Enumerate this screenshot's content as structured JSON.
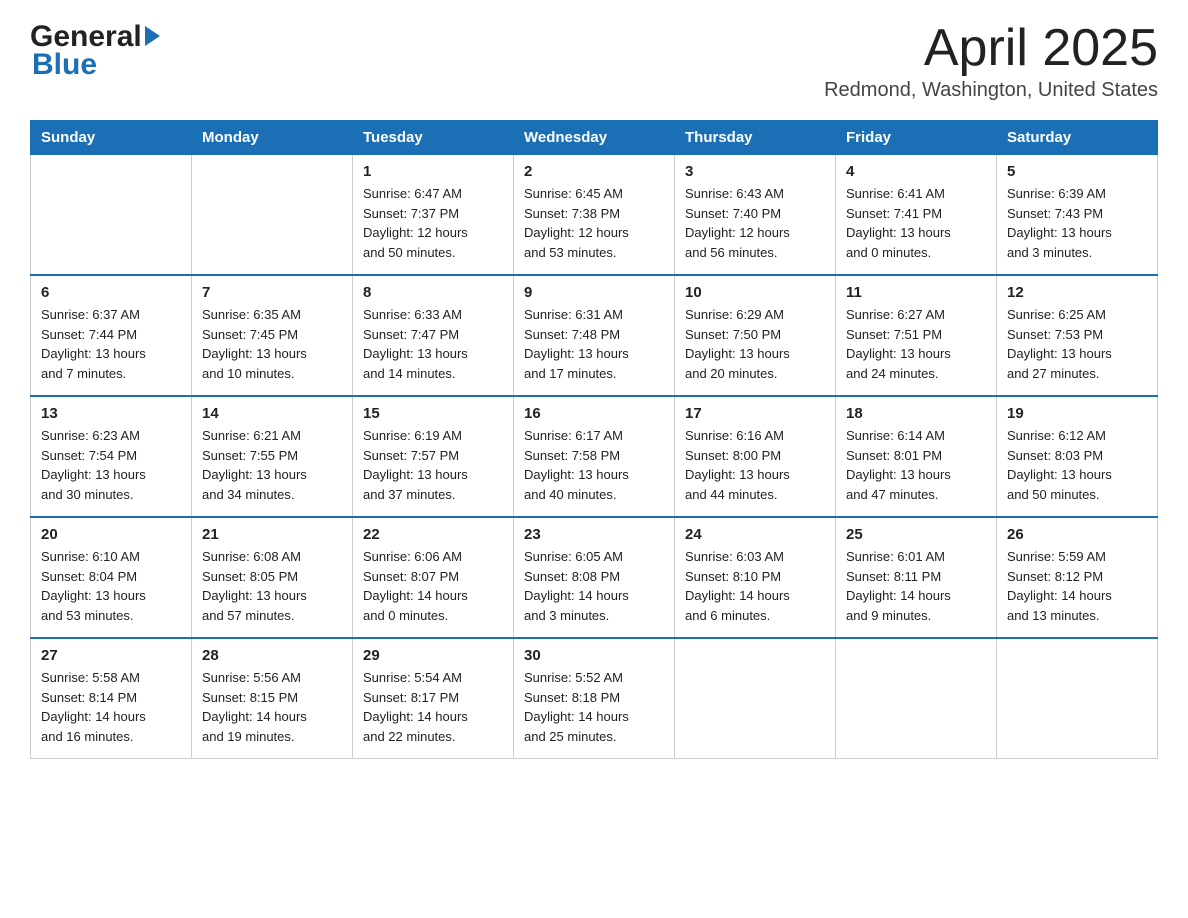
{
  "header": {
    "logo_general": "General",
    "logo_blue": "Blue",
    "month_title": "April 2025",
    "location": "Redmond, Washington, United States"
  },
  "calendar": {
    "days_of_week": [
      "Sunday",
      "Monday",
      "Tuesday",
      "Wednesday",
      "Thursday",
      "Friday",
      "Saturday"
    ],
    "weeks": [
      [
        {
          "day": "",
          "info": ""
        },
        {
          "day": "",
          "info": ""
        },
        {
          "day": "1",
          "info": "Sunrise: 6:47 AM\nSunset: 7:37 PM\nDaylight: 12 hours\nand 50 minutes."
        },
        {
          "day": "2",
          "info": "Sunrise: 6:45 AM\nSunset: 7:38 PM\nDaylight: 12 hours\nand 53 minutes."
        },
        {
          "day": "3",
          "info": "Sunrise: 6:43 AM\nSunset: 7:40 PM\nDaylight: 12 hours\nand 56 minutes."
        },
        {
          "day": "4",
          "info": "Sunrise: 6:41 AM\nSunset: 7:41 PM\nDaylight: 13 hours\nand 0 minutes."
        },
        {
          "day": "5",
          "info": "Sunrise: 6:39 AM\nSunset: 7:43 PM\nDaylight: 13 hours\nand 3 minutes."
        }
      ],
      [
        {
          "day": "6",
          "info": "Sunrise: 6:37 AM\nSunset: 7:44 PM\nDaylight: 13 hours\nand 7 minutes."
        },
        {
          "day": "7",
          "info": "Sunrise: 6:35 AM\nSunset: 7:45 PM\nDaylight: 13 hours\nand 10 minutes."
        },
        {
          "day": "8",
          "info": "Sunrise: 6:33 AM\nSunset: 7:47 PM\nDaylight: 13 hours\nand 14 minutes."
        },
        {
          "day": "9",
          "info": "Sunrise: 6:31 AM\nSunset: 7:48 PM\nDaylight: 13 hours\nand 17 minutes."
        },
        {
          "day": "10",
          "info": "Sunrise: 6:29 AM\nSunset: 7:50 PM\nDaylight: 13 hours\nand 20 minutes."
        },
        {
          "day": "11",
          "info": "Sunrise: 6:27 AM\nSunset: 7:51 PM\nDaylight: 13 hours\nand 24 minutes."
        },
        {
          "day": "12",
          "info": "Sunrise: 6:25 AM\nSunset: 7:53 PM\nDaylight: 13 hours\nand 27 minutes."
        }
      ],
      [
        {
          "day": "13",
          "info": "Sunrise: 6:23 AM\nSunset: 7:54 PM\nDaylight: 13 hours\nand 30 minutes."
        },
        {
          "day": "14",
          "info": "Sunrise: 6:21 AM\nSunset: 7:55 PM\nDaylight: 13 hours\nand 34 minutes."
        },
        {
          "day": "15",
          "info": "Sunrise: 6:19 AM\nSunset: 7:57 PM\nDaylight: 13 hours\nand 37 minutes."
        },
        {
          "day": "16",
          "info": "Sunrise: 6:17 AM\nSunset: 7:58 PM\nDaylight: 13 hours\nand 40 minutes."
        },
        {
          "day": "17",
          "info": "Sunrise: 6:16 AM\nSunset: 8:00 PM\nDaylight: 13 hours\nand 44 minutes."
        },
        {
          "day": "18",
          "info": "Sunrise: 6:14 AM\nSunset: 8:01 PM\nDaylight: 13 hours\nand 47 minutes."
        },
        {
          "day": "19",
          "info": "Sunrise: 6:12 AM\nSunset: 8:03 PM\nDaylight: 13 hours\nand 50 minutes."
        }
      ],
      [
        {
          "day": "20",
          "info": "Sunrise: 6:10 AM\nSunset: 8:04 PM\nDaylight: 13 hours\nand 53 minutes."
        },
        {
          "day": "21",
          "info": "Sunrise: 6:08 AM\nSunset: 8:05 PM\nDaylight: 13 hours\nand 57 minutes."
        },
        {
          "day": "22",
          "info": "Sunrise: 6:06 AM\nSunset: 8:07 PM\nDaylight: 14 hours\nand 0 minutes."
        },
        {
          "day": "23",
          "info": "Sunrise: 6:05 AM\nSunset: 8:08 PM\nDaylight: 14 hours\nand 3 minutes."
        },
        {
          "day": "24",
          "info": "Sunrise: 6:03 AM\nSunset: 8:10 PM\nDaylight: 14 hours\nand 6 minutes."
        },
        {
          "day": "25",
          "info": "Sunrise: 6:01 AM\nSunset: 8:11 PM\nDaylight: 14 hours\nand 9 minutes."
        },
        {
          "day": "26",
          "info": "Sunrise: 5:59 AM\nSunset: 8:12 PM\nDaylight: 14 hours\nand 13 minutes."
        }
      ],
      [
        {
          "day": "27",
          "info": "Sunrise: 5:58 AM\nSunset: 8:14 PM\nDaylight: 14 hours\nand 16 minutes."
        },
        {
          "day": "28",
          "info": "Sunrise: 5:56 AM\nSunset: 8:15 PM\nDaylight: 14 hours\nand 19 minutes."
        },
        {
          "day": "29",
          "info": "Sunrise: 5:54 AM\nSunset: 8:17 PM\nDaylight: 14 hours\nand 22 minutes."
        },
        {
          "day": "30",
          "info": "Sunrise: 5:52 AM\nSunset: 8:18 PM\nDaylight: 14 hours\nand 25 minutes."
        },
        {
          "day": "",
          "info": ""
        },
        {
          "day": "",
          "info": ""
        },
        {
          "day": "",
          "info": ""
        }
      ]
    ]
  }
}
